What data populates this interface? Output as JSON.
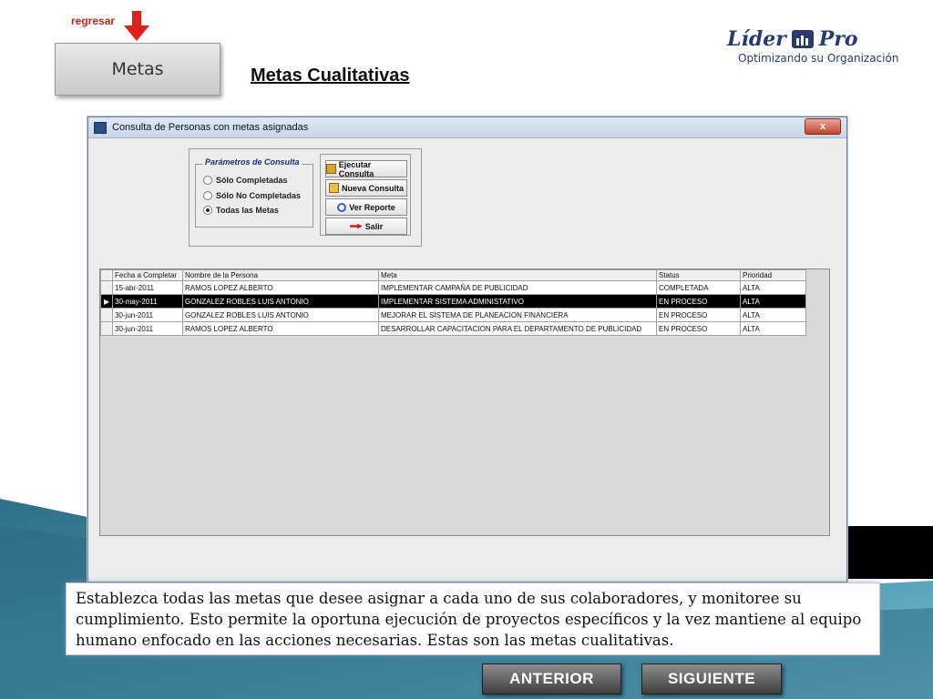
{
  "nav": {
    "back_link": "regresar",
    "section_button": "Metas"
  },
  "page": {
    "title": "Metas Cualitativas"
  },
  "logo": {
    "name_part1": "Líder",
    "name_part2": "Pro",
    "tagline": "Optimizando su Organización"
  },
  "window": {
    "title": "Consulta de Personas con metas asignadas",
    "close_label": "x",
    "params": {
      "legend": "Parámetros de Consulta",
      "options": [
        {
          "label": "Sólo Completadas",
          "selected": false
        },
        {
          "label": "Sólo No Completadas",
          "selected": false
        },
        {
          "label": "Todas las Metas",
          "selected": true
        }
      ]
    },
    "buttons": {
      "execute": "Ejecutar Consulta",
      "new": "Nueva Consulta",
      "report": "Ver Reporte",
      "exit": "Salir"
    },
    "grid": {
      "columns": [
        "Fecha a Completar",
        "Nombre de la Persona",
        "Meta",
        "Status",
        "Prioridad"
      ],
      "rows": [
        {
          "fecha": "15-abr-2011",
          "nombre": "RAMOS LOPEZ ALBERTO",
          "meta": "IMPLEMENTAR CAMPAÑA DE PUBLICIDAD",
          "status": "COMPLETADA",
          "prioridad": "ALTA",
          "selected": false
        },
        {
          "fecha": "30-may-2011",
          "nombre": "GONZALEZ ROBLES LUIS ANTONIO",
          "meta": "IMPLEMENTAR SISTEMA ADMINISTATIVO",
          "status": "EN PROCESO",
          "prioridad": "ALTA",
          "selected": true
        },
        {
          "fecha": "30-jun-2011",
          "nombre": "GONZALEZ ROBLES LUIS ANTONIO",
          "meta": "MEJORAR EL SISTEMA DE PLANEACION FINANCIERA",
          "status": "EN PROCESO",
          "prioridad": "ALTA",
          "selected": false
        },
        {
          "fecha": "30-jun-2011",
          "nombre": "RAMOS LOPEZ ALBERTO",
          "meta": "DESARROLLAR CAPACITACION PARA EL DEPARTAMENTO DE PUBLICIDAD",
          "status": "EN PROCESO",
          "prioridad": "ALTA",
          "selected": false
        }
      ]
    }
  },
  "description": "Establezca todas las metas que desee asignar a cada uno de sus colaboradores, y monitoree su cumplimiento. Esto permite la oportuna ejecución de proyectos específicos y la vez mantiene al equipo humano enfocado en las acciones necesarias. Estas son las metas cualitativas.",
  "footer": {
    "prev_label": "ANTERIOR",
    "next_label": "SIGUIENTE"
  },
  "colors": {
    "accent_red": "#c0241b",
    "logo_blue": "#2a3a6e",
    "wave_teal": "#3d8aa3",
    "selected_row": "#000000"
  }
}
